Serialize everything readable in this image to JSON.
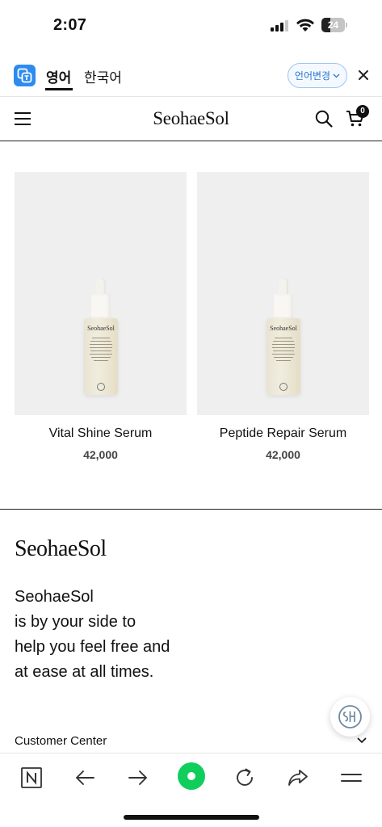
{
  "status_bar": {
    "time": "2:07",
    "battery": "24"
  },
  "translate_bar": {
    "active_language": "영어",
    "other_language": "한국어",
    "change_language_label": "언어변경"
  },
  "header": {
    "logo": "SeohaeSol",
    "cart_count": "0"
  },
  "products": [
    {
      "name": "Vital Shine Serum",
      "price": "42,000",
      "image_brand": "SeohaeSol"
    },
    {
      "name": "Peptide Repair Serum",
      "price": "42,000",
      "image_brand": "SeohaeSol"
    }
  ],
  "footer": {
    "logo": "SeohaeSol",
    "tagline": [
      "SeohaeSol",
      "is by your side to",
      "help you feel free and",
      "at ease at all times."
    ],
    "customer_center": "Customer Center"
  },
  "colors": {
    "accent_green": "#0fce5b",
    "translate_blue": "#2d8bf0"
  }
}
